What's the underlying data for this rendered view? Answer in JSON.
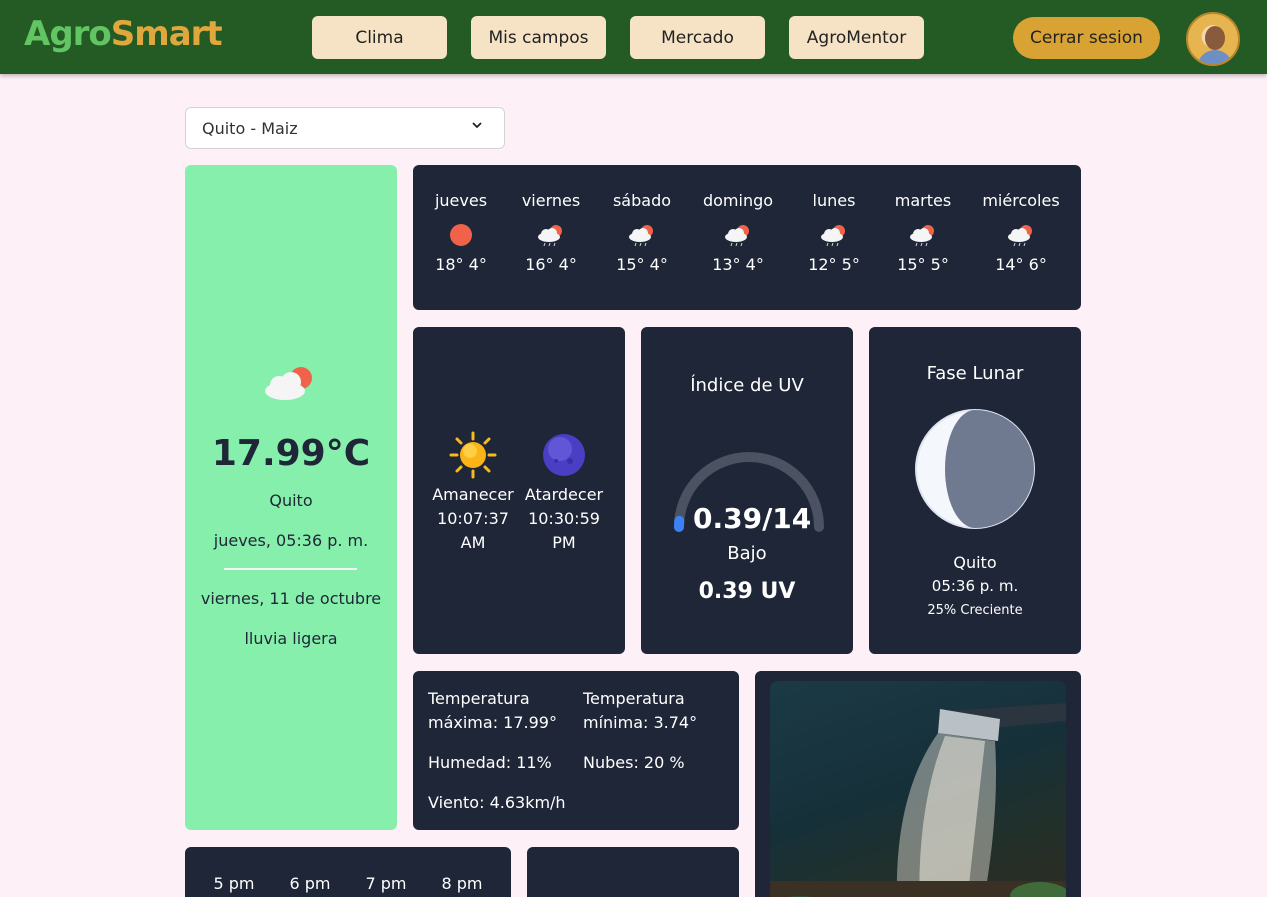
{
  "header": {
    "logo_part1": "Agro",
    "logo_part2": "Smart",
    "nav": [
      "Clima",
      "Mis campos",
      "Mercado",
      "AgroMentor"
    ],
    "logout": "Cerrar sesion",
    "colors": {
      "bar": "#245a24",
      "nav_button": "#f6e3c5",
      "logout_button": "#d9a333"
    }
  },
  "location_select": {
    "value": "Quito - Maiz"
  },
  "current": {
    "icon": "cloud-sun-icon",
    "temp": "17.99°C",
    "city": "Quito",
    "time": "jueves, 05:36 p. m.",
    "date": "viernes, 11 de octubre",
    "description": "lluvia ligera",
    "color": "#86efac"
  },
  "forecast": [
    {
      "day": "jueves",
      "range": "18° 4°",
      "icon": "sun-icon"
    },
    {
      "day": "viernes",
      "range": "16° 4°",
      "icon": "rain-cloud-icon"
    },
    {
      "day": "sábado",
      "range": "15° 4°",
      "icon": "rain-cloud-icon"
    },
    {
      "day": "domingo",
      "range": "13° 4°",
      "icon": "rain-cloud-icon"
    },
    {
      "day": "lunes",
      "range": "12° 5°",
      "icon": "rain-cloud-icon"
    },
    {
      "day": "martes",
      "range": "15° 5°",
      "icon": "rain-cloud-icon"
    },
    {
      "day": "miércoles",
      "range": "14° 6°",
      "icon": "rain-cloud-icon"
    }
  ],
  "sun": {
    "sunrise_label": "Amanecer",
    "sunrise_time": "10:07:37",
    "sunrise_ampm": "AM",
    "sunset_label": "Atardecer",
    "sunset_time": "10:30:59",
    "sunset_ampm": "PM"
  },
  "uv": {
    "title": "Índice de UV",
    "value_text": "0.39/14",
    "level": "Bajo",
    "uv_text": "0.39 UV",
    "value": 0.39,
    "max": 14
  },
  "moon": {
    "title": "Fase Lunar",
    "city": "Quito",
    "time": "05:36 p. m.",
    "phase": "25% Creciente",
    "illumination": 0.25
  },
  "stats": {
    "tmax_line1": "Temperatura",
    "tmax_line2": "máxima: 17.99°",
    "tmin_line1": "Temperatura",
    "tmin_line2": "mínima: 3.74°",
    "humidity": "Humedad: 11%",
    "clouds": "Nubes: 20 %",
    "wind": "Viento: 4.63km/h"
  },
  "hourly": [
    "5 pm",
    "6 pm",
    "7 pm",
    "8 pm"
  ]
}
